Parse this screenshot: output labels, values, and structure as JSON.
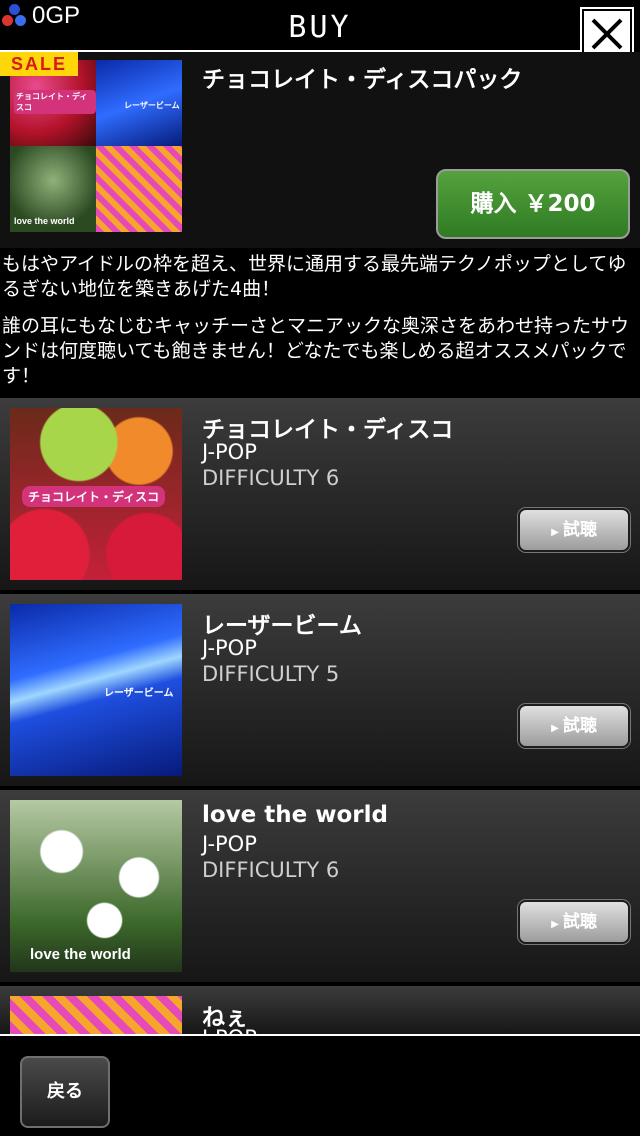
{
  "header": {
    "gp_value": "0GP",
    "title": "BUY"
  },
  "pack": {
    "badge": "SALE",
    "title": "チョコレイト・ディスコパック",
    "buy_label": "購入 ￥200",
    "art_labels": [
      "チョコレイト・ディスコ",
      "レーザービーム",
      "love the world"
    ],
    "description": [
      "もはやアイドルの枠を超え、世界に通用する最先端テクノポップとしてゆるぎない地位を築きあげた4曲！",
      "誰の耳にもなじむキャッチーさとマニアックな奥深さをあわせ持ったサウンドは何度聴いても飽きません！どなたでも楽しめる超オススメパックです！"
    ]
  },
  "songs": [
    {
      "title": "チョコレイト・ディスコ",
      "genre": "J-POP",
      "difficulty": "DIFFICULTY 6",
      "listen_label": "試聴",
      "art_label": "チョコレイト・ディスコ"
    },
    {
      "title": "レーザービーム",
      "genre": "J-POP",
      "difficulty": "DIFFICULTY 5",
      "listen_label": "試聴",
      "art_label": "レーザービーム"
    },
    {
      "title": "love the world",
      "genre": "J-POP",
      "difficulty": "DIFFICULTY 6",
      "listen_label": "試聴",
      "art_label": "love the world"
    },
    {
      "title": "ねぇ",
      "genre": "J-POP"
    }
  ],
  "footer": {
    "back_label": "戻る"
  }
}
